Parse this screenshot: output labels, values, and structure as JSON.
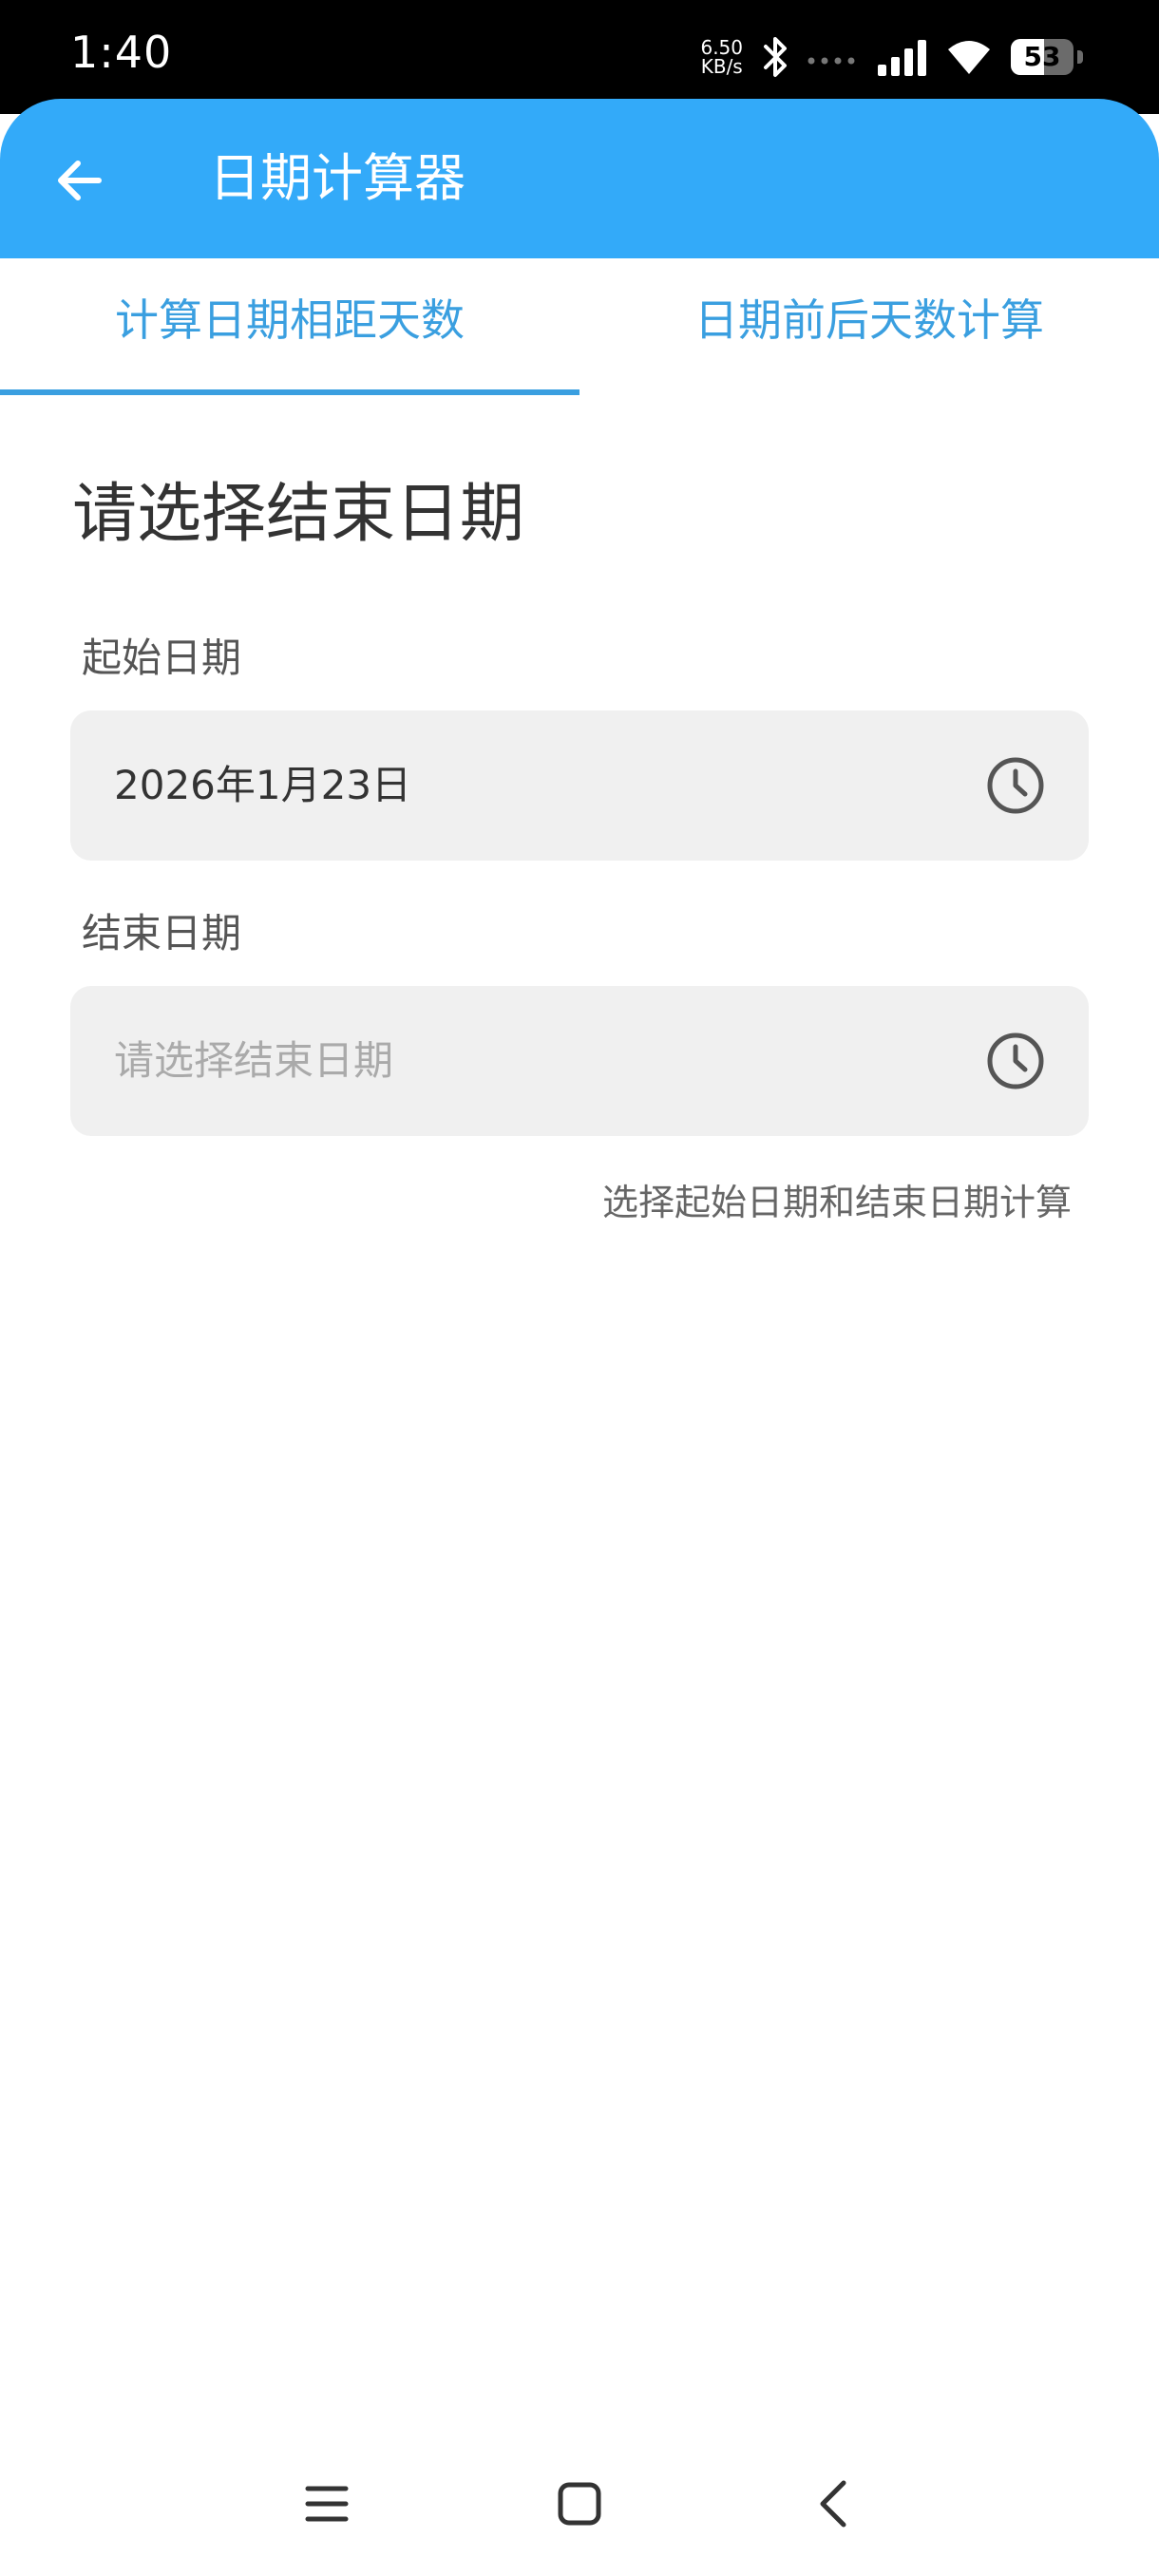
{
  "status_bar": {
    "time": "1:40",
    "net_speed_value": "6.50",
    "net_speed_unit": "KB/s",
    "battery_level": "53",
    "battery_fraction": 0.53,
    "icons": [
      "bluetooth-icon",
      "signal-dots-icon",
      "cellular-signal-icon",
      "wifi-icon",
      "battery-icon"
    ]
  },
  "app_bar": {
    "title": "日期计算器",
    "back_icon": "arrow-back-icon",
    "color": "#33aaf9"
  },
  "tabs": [
    {
      "label": "计算日期相距天数",
      "selected": true
    },
    {
      "label": "日期前后天数计算",
      "selected": false
    }
  ],
  "main": {
    "heading": "请选择结束日期",
    "start_date": {
      "label": "起始日期",
      "value": "2026年1月23日",
      "icon": "clock-icon"
    },
    "end_date": {
      "label": "结束日期",
      "placeholder": "请选择结束日期",
      "icon": "clock-icon"
    },
    "hint": "选择起始日期和结束日期计算"
  },
  "nav_bar": {
    "icons": [
      "menu-icon",
      "home-icon",
      "back-icon"
    ]
  },
  "colors": {
    "accent": "#33aaf9",
    "tab_text": "#3a9fe0",
    "field_bg": "#f0f0f0"
  }
}
